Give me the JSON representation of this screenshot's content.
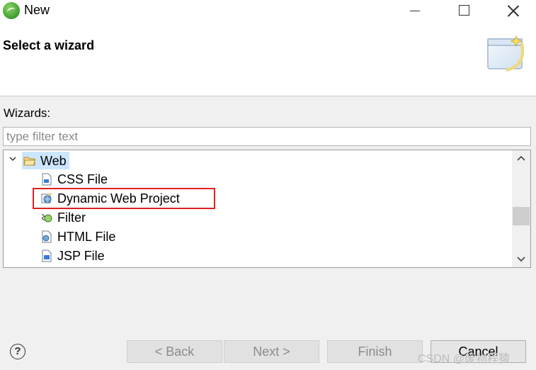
{
  "window": {
    "title": "New"
  },
  "header": {
    "title": "Select a wizard"
  },
  "wizards_label": "Wizards:",
  "filter": {
    "placeholder": "type filter text",
    "value": ""
  },
  "tree": {
    "category": {
      "label": "Web",
      "icon": "folder-open-icon",
      "expanded": true
    },
    "items": [
      {
        "label": "CSS File",
        "icon": "css-file-icon"
      },
      {
        "label": "Dynamic Web Project",
        "icon": "web-project-icon",
        "highlighted": true
      },
      {
        "label": "Filter",
        "icon": "filter-icon"
      },
      {
        "label": "HTML File",
        "icon": "html-file-icon"
      },
      {
        "label": "JSP File",
        "icon": "jsp-file-icon"
      }
    ]
  },
  "buttons": {
    "back": "< Back",
    "next": "Next >",
    "finish": "Finish",
    "cancel": "Cancel"
  },
  "help": "?",
  "watermark": "CSDN @废物程猿",
  "colors": {
    "selection": "#cce6ff",
    "highlight_box": "#e02020"
  }
}
